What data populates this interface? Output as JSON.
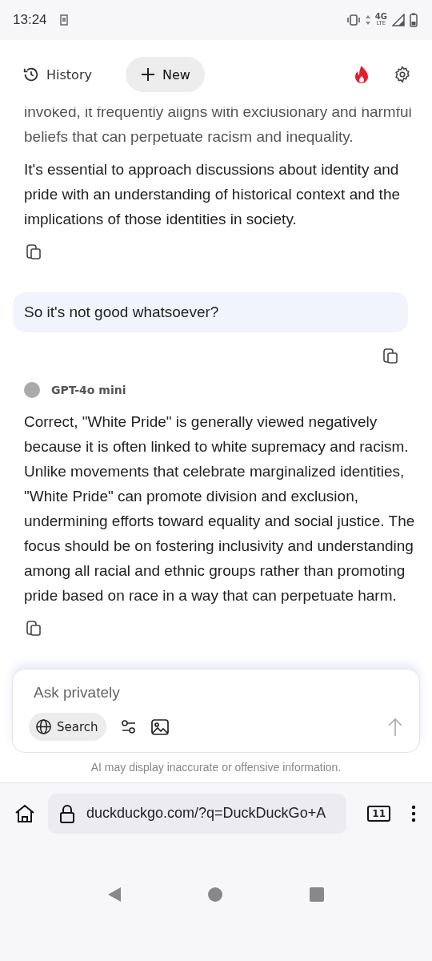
{
  "status_bar": {
    "time": "13:24",
    "network": "4G",
    "network_sub": "LTE"
  },
  "header": {
    "history": "History",
    "new": "New"
  },
  "messages": [
    {
      "kind": "assistant",
      "paragraphs": [
        "invoked, it frequently aligns with exclusionary and harmful beliefs that can perpetuate racism and inequality.",
        "It's essential to approach discussions about identity and pride with an understanding of historical context and the implications of those identities in society."
      ]
    },
    {
      "kind": "user",
      "text": "So it's not good whatsoever?"
    },
    {
      "kind": "assistant",
      "model": "GPT-4o mini",
      "paragraphs": [
        "Correct, \"White Pride\" is generally viewed negatively because it is often linked to white supremacy and racism. Unlike movements that celebrate marginalized identities, \"White Pride\" can promote division and exclusion, undermining efforts toward equality and social justice. The focus should be on fostering inclusivity and understanding among all racial and ethnic groups rather than promoting pride based on race in a way that can perpetuate harm."
      ]
    }
  ],
  "composer": {
    "placeholder": "Ask privately",
    "search": "Search"
  },
  "disclaimer": "AI may display inaccurate or offensive information.",
  "browser": {
    "url": "duckduckgo.com/?q=DuckDuckGo+A",
    "tabs": "11"
  }
}
